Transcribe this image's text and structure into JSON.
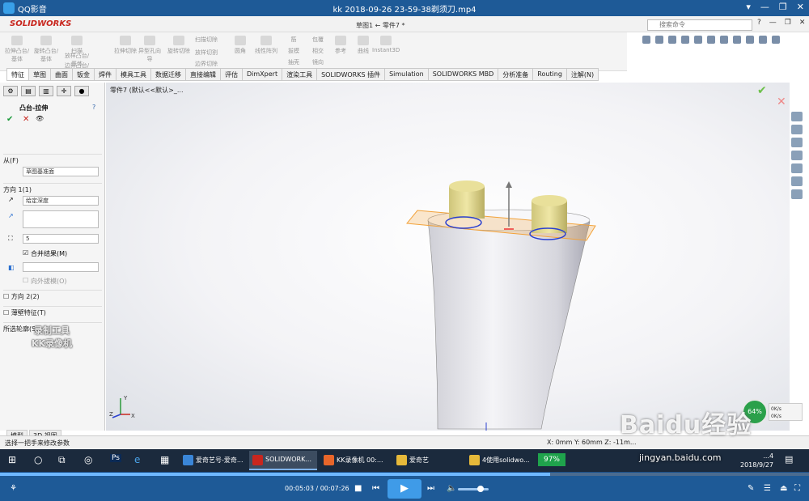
{
  "player": {
    "app_name": "QQ影音",
    "filename": "kk 2018-09-26 23-59-38剃须刀.mp4",
    "time_current": "00:05:03",
    "time_total": "00:07:26",
    "progress": 0.68,
    "window_controls": [
      "▾",
      "—",
      "❐",
      "✕"
    ]
  },
  "sw": {
    "logo": "SOLIDWORKS",
    "doc_title": "草图1 ← 零件7 *",
    "search_placeholder": "搜索命令",
    "command_labels": [
      "拉伸凸台/基体",
      "旋转凸台/基体",
      "扫描",
      "放样凸台/基体",
      "边界凸台/基体",
      "拉伸切除",
      "异型孔向导",
      "旋转切除",
      "扫描切除",
      "放样切割",
      "边界切除",
      "圆角",
      "线性阵列",
      "筋",
      "拔模",
      "抽壳",
      "包覆",
      "相交",
      "镜向",
      "参考",
      "曲线",
      "Instant3D"
    ],
    "tabs": [
      "特征",
      "草图",
      "曲面",
      "钣金",
      "焊件",
      "模具工具",
      "数据迁移",
      "直接编辑",
      "评估",
      "DimXpert",
      "渲染工具",
      "SOLIDWORKS 插件",
      "Simulation",
      "SOLIDWORKS MBD",
      "分析准备",
      "Routing",
      "注解(N)"
    ],
    "feature_tree_tag": "零件7 (默认<<默认>_...",
    "pm": {
      "title": "凸台-拉伸",
      "from_label": "从(F)",
      "from_value": "草图基准面",
      "dir1_label": "方向 1(1)",
      "dir1_value": "给定深度",
      "depth_value": "5",
      "merge_label": "合并结果(M)",
      "draft_label": "向外拔模(O)",
      "dir2_label": "方向 2(2)",
      "thin_label": "薄壁特征(T)",
      "contour_label": "所选轮廓(S)"
    },
    "bottom_tabs": [
      "模型",
      "3D 视图"
    ],
    "status_left": "选择一把手来修改参数",
    "status_right": "X: 0mm Y: 60mm Z: -11m..."
  },
  "taskbar": {
    "items": [
      "爱奇艺号-爱奇...",
      "SOLIDWORK...",
      "KK录像机 00:...",
      "爱奇艺",
      "4使用solidwo..."
    ],
    "battery_pct": "97%",
    "clock_time": "...4",
    "clock_date": "2018/9/27"
  },
  "overlays": {
    "watermark_line1": "录制工具",
    "watermark_line2": "KK录像机",
    "baidu_logo": "Baidu经验",
    "baidu_url": "jingyan.baidu.com",
    "speed_pct": "64%",
    "speed_up": "0K/s",
    "speed_down": "0K/s"
  },
  "colors": {
    "player_bar": "#1e5a97",
    "sw_red": "#c8261e",
    "model_body": "#e9e9ee",
    "cyl": "#e3da8a",
    "preview": "#f2a23a"
  }
}
